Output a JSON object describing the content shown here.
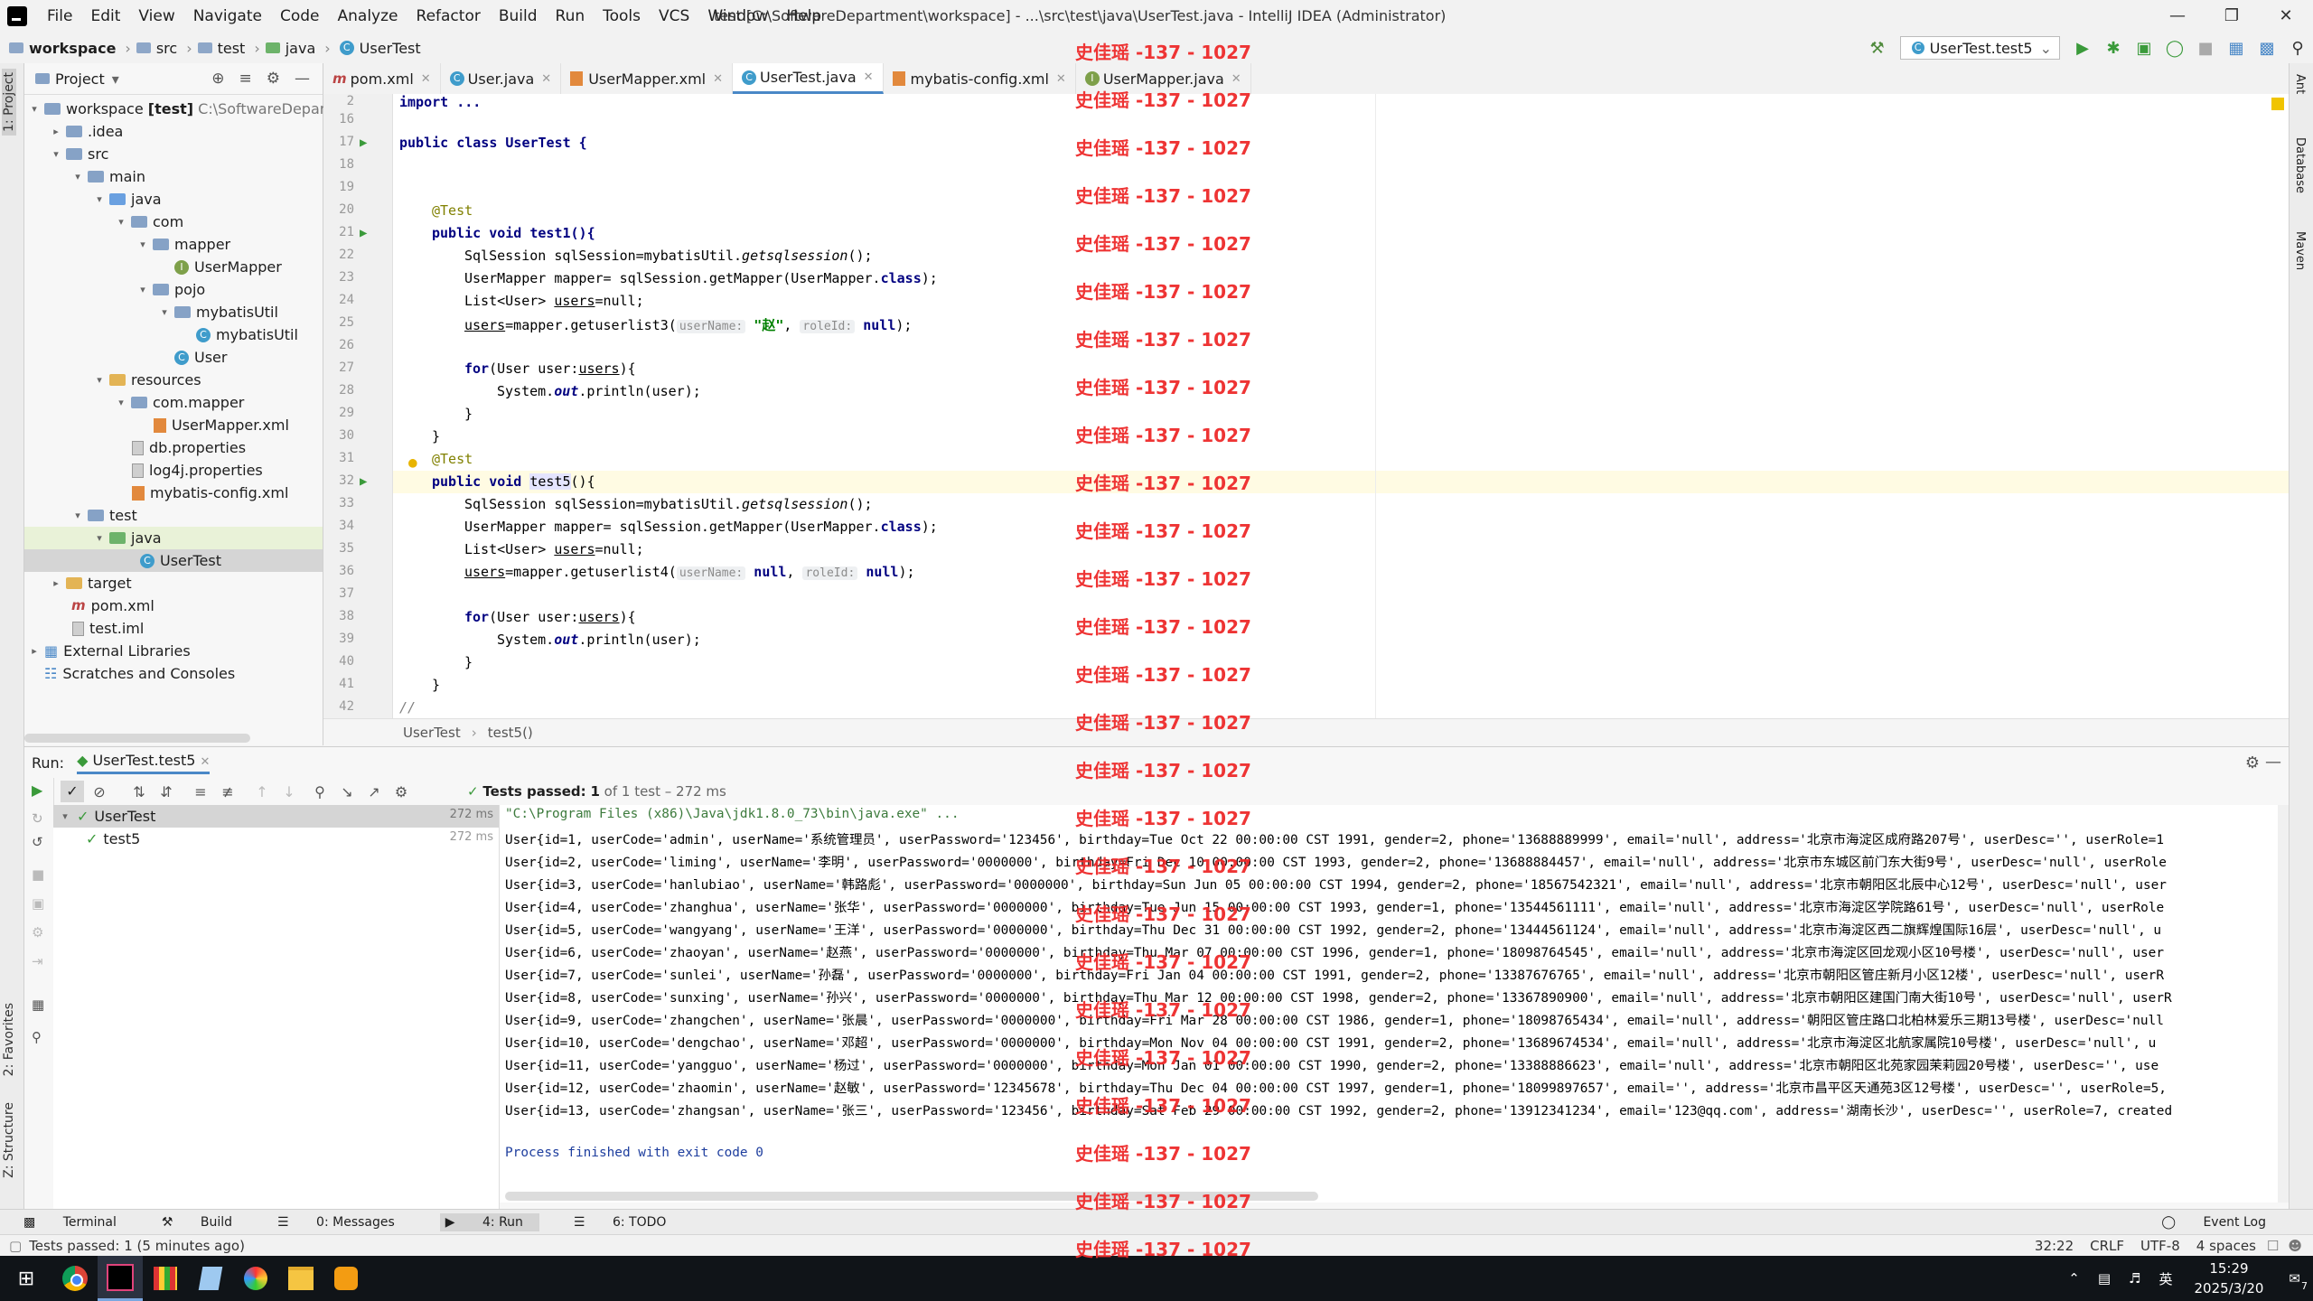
{
  "window": {
    "menu": [
      "File",
      "Edit",
      "View",
      "Navigate",
      "Code",
      "Analyze",
      "Refactor",
      "Build",
      "Run",
      "Tools",
      "VCS",
      "Window",
      "Help"
    ],
    "title": "test [C:\\SoftwareDepartment\\workspace] - ...\\src\\test\\java\\UserTest.java - IntelliJ IDEA (Administrator)"
  },
  "breadcrumb": [
    "workspace",
    "src",
    "test",
    "java",
    "UserTest"
  ],
  "run_config": "UserTest.test5",
  "project": {
    "header": "Project",
    "tree": [
      {
        "label": "workspace",
        "bold": "[test]",
        "path": "C:\\SoftwareDepartm"
      },
      {
        "label": ".idea"
      },
      {
        "label": "src"
      },
      {
        "label": "main"
      },
      {
        "label": "java"
      },
      {
        "label": "com"
      },
      {
        "label": "mapper"
      },
      {
        "label": "UserMapper"
      },
      {
        "label": "pojo"
      },
      {
        "label": "mybatisUtil"
      },
      {
        "label": "mybatisUtil"
      },
      {
        "label": "User"
      },
      {
        "label": "resources"
      },
      {
        "label": "com.mapper"
      },
      {
        "label": "UserMapper.xml"
      },
      {
        "label": "db.properties"
      },
      {
        "label": "log4j.properties"
      },
      {
        "label": "mybatis-config.xml"
      },
      {
        "label": "test"
      },
      {
        "label": "java"
      },
      {
        "label": "UserTest"
      },
      {
        "label": "target"
      },
      {
        "label": "pom.xml"
      },
      {
        "label": "test.iml"
      },
      {
        "label": "External Libraries"
      },
      {
        "label": "Scratches and Consoles"
      }
    ]
  },
  "tabs": [
    "pom.xml",
    "User.java",
    "UserMapper.xml",
    "UserTest.java",
    "mybatis-config.xml",
    "UserMapper.java"
  ],
  "editor": {
    "line_numbers": [
      "2",
      "16",
      "17",
      "18",
      "19",
      "20",
      "21",
      "22",
      "23",
      "24",
      "25",
      "26",
      "27",
      "28",
      "29",
      "30",
      "31",
      "32",
      "33",
      "34",
      "35",
      "36",
      "37",
      "38",
      "39",
      "40",
      "41",
      "42"
    ],
    "code": {
      "l2": "import ...",
      "l17": "public class UserTest {",
      "l20": "@Test",
      "l21": "public void test1(){",
      "l22a": "SqlSession sqlSession=mybatisUtil.",
      "l22b": "getsqlsession",
      "l22c": "();",
      "l23a": "UserMapper mapper= sqlSession.getMapper(UserMapper.",
      "l23b": "class",
      "l23c": ");",
      "l24a": "List<User> ",
      "l24b": "users",
      "l24c": "=null;",
      "l25a": "users",
      "l25b": "=mapper.getuserlist3(",
      "l25h1": "userName:",
      "l25s": "\"赵\"",
      "l25c": ", ",
      "l25h2": "roleId:",
      "l25n": "null",
      "l25d": ");",
      "l27a": "for",
      "l27b": "(User user:",
      "l27c": "users",
      "l27d": "){",
      "l28a": "System.",
      "l28b": "out",
      "l28c": ".println(user);",
      "l29": "}",
      "l30": "}",
      "l31": "@Test",
      "l32a": "public void ",
      "l32b": "test5",
      "l32c": "(){",
      "l33a": "SqlSession sqlSession=mybatisUtil.",
      "l33b": "getsqlsession",
      "l33c": "();",
      "l34a": "UserMapper mapper= sqlSession.getMapper(UserMapper.",
      "l34b": "class",
      "l34c": ");",
      "l35a": "List<User> ",
      "l35b": "users",
      "l35c": "=null;",
      "l36a": "users",
      "l36b": "=mapper.getuserlist4(",
      "l36h1": "userName:",
      "l36n1": "null",
      "l36c": ", ",
      "l36h2": "roleId:",
      "l36n2": "null",
      "l36d": ");",
      "l38a": "for",
      "l38b": "(User user:",
      "l38c": "users",
      "l38d": "){",
      "l39a": "System.",
      "l39b": "out",
      "l39c": ".println(user);",
      "l40": "}",
      "l41": "}",
      "l42": "//"
    },
    "breadcrumb": [
      "UserTest",
      "test5()"
    ]
  },
  "run": {
    "label": "Run:",
    "tab": "UserTest.test5",
    "status": "Tests passed:",
    "status_count": "1",
    "status_rest": "of 1 test – 272 ms",
    "tree": [
      {
        "label": "UserTest",
        "time": "272 ms"
      },
      {
        "label": "test5",
        "time": "272 ms"
      }
    ],
    "console": [
      "\"C:\\Program Files (x86)\\Java\\jdk1.8.0_73\\bin\\java.exe\" ...",
      "User{id=1, userCode='admin', userName='系统管理员', userPassword='123456', birthday=Tue Oct 22 00:00:00 CST 1991, gender=2, phone='13688889999', email='null', address='北京市海淀区成府路207号', userDesc='', userRole=1",
      "User{id=2, userCode='liming', userName='李明', userPassword='0000000', birthday=Fri Dec 10 00:00:00 CST 1993, gender=2, phone='13688884457', email='null', address='北京市东城区前门东大街9号', userDesc='null', userRole",
      "User{id=3, userCode='hanlubiao', userName='韩路彪', userPassword='0000000', birthday=Sun Jun 05 00:00:00 CST 1994, gender=2, phone='18567542321', email='null', address='北京市朝阳区北辰中心12号', userDesc='null', user",
      "User{id=4, userCode='zhanghua', userName='张华', userPassword='0000000', birthday=Tue Jun 15 00:00:00 CST 1993, gender=1, phone='13544561111', email='null', address='北京市海淀区学院路61号', userDesc='null', userRole",
      "User{id=5, userCode='wangyang', userName='王洋', userPassword='0000000', birthday=Thu Dec 31 00:00:00 CST 1992, gender=2, phone='13444561124', email='null', address='北京市海淀区西二旗辉煌国际16层', userDesc='null', u",
      "User{id=6, userCode='zhaoyan', userName='赵燕', userPassword='0000000', birthday=Thu Mar 07 00:00:00 CST 1996, gender=1, phone='18098764545', email='null', address='北京市海淀区回龙观小区10号楼', userDesc='null', user",
      "User{id=7, userCode='sunlei', userName='孙磊', userPassword='0000000', birthday=Fri Jan 04 00:00:00 CST 1991, gender=2, phone='13387676765', email='null', address='北京市朝阳区管庄新月小区12楼', userDesc='null', userR",
      "User{id=8, userCode='sunxing', userName='孙兴', userPassword='0000000', birthday=Thu Mar 12 00:00:00 CST 1998, gender=2, phone='13367890900', email='null', address='北京市朝阳区建国门南大街10号', userDesc='null', userR",
      "User{id=9, userCode='zhangchen', userName='张晨', userPassword='0000000', birthday=Fri Mar 28 00:00:00 CST 1986, gender=1, phone='18098765434', email='null', address='朝阳区管庄路口北柏林爱乐三期13号楼', userDesc='null",
      "User{id=10, userCode='dengchao', userName='邓超', userPassword='0000000', birthday=Mon Nov 04 00:00:00 CST 1991, gender=2, phone='13689674534', email='null', address='北京市海淀区北航家属院10号楼', userDesc='null', u",
      "User{id=11, userCode='yangguo', userName='杨过', userPassword='0000000', birthday=Mon Jan 01 00:00:00 CST 1990, gender=2, phone='13388886623', email='null', address='北京市朝阳区北苑家园茉莉园20号楼', userDesc='', use",
      "User{id=12, userCode='zhaomin', userName='赵敏', userPassword='12345678', birthday=Thu Dec 04 00:00:00 CST 1997, gender=1, phone='18099897657', email='', address='北京市昌平区天通苑3区12号楼', userDesc='', userRole=5,",
      "User{id=13, userCode='zhangsan', userName='张三', userPassword='123456', birthday=Sat Feb 29 00:00:00 CST 1992, gender=2, phone='13912341234', email='123@qq.com', address='湖南长沙', userDesc='', userRole=7, created",
      "",
      "Process finished with exit code 0"
    ]
  },
  "left_strip": [
    "1: Project",
    "2: Favorites",
    "Z: Structure"
  ],
  "right_strip": [
    "Ant",
    "Database",
    "Maven"
  ],
  "bottom_tabs": [
    "Terminal",
    "Build",
    "0: Messages",
    "4: Run",
    "6: TODO"
  ],
  "event_log": "Event Log",
  "status": {
    "message": "Tests passed: 1 (5 minutes ago)",
    "position": "32:22",
    "line_sep": "CRLF",
    "encoding": "UTF-8",
    "indent": "4 spaces"
  },
  "taskbar": {
    "ime": "英",
    "time": "15:29",
    "date": "2025/3/20",
    "notif_count": "7"
  },
  "watermark": "史佳瑶 -137 - 1027",
  "colors": {
    "accent": "#4a88c7",
    "watermark": "#ee2a2a",
    "pass": "#3c9a3c"
  }
}
